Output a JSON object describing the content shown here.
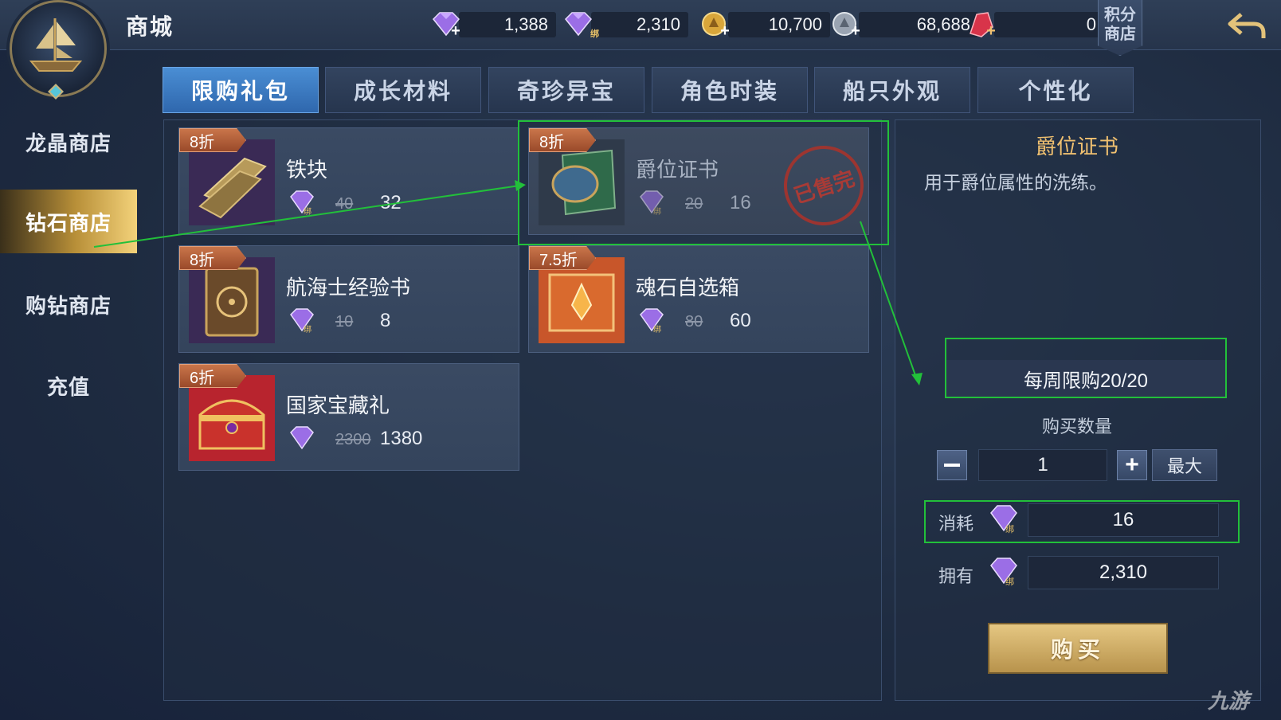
{
  "header": {
    "title": "商城",
    "points_shop_label": "积分商店"
  },
  "currencies": [
    {
      "name": "diamond",
      "value": "1,388"
    },
    {
      "name": "bound-diamond",
      "value": "2,310",
      "tag": "绑"
    },
    {
      "name": "gold",
      "value": "10,700"
    },
    {
      "name": "silver",
      "value": "68,688"
    },
    {
      "name": "red-crystal",
      "value": "0"
    }
  ],
  "sidebar": {
    "items": [
      {
        "label": "龙晶商店",
        "active": false
      },
      {
        "label": "钻石商店",
        "active": true
      },
      {
        "label": "购钻商店",
        "active": false
      },
      {
        "label": "充值",
        "active": false
      }
    ]
  },
  "tabs": [
    {
      "label": "限购礼包",
      "active": true
    },
    {
      "label": "成长材料",
      "active": false
    },
    {
      "label": "奇珍异宝",
      "active": false
    },
    {
      "label": "角色时装",
      "active": false
    },
    {
      "label": "船只外观",
      "active": false
    },
    {
      "label": "个性化",
      "active": false
    }
  ],
  "items": [
    {
      "discount": "8折",
      "name": "铁块",
      "old_price": "40",
      "price": "32",
      "currency_tag": "绑",
      "sold_out": false
    },
    {
      "discount": "8折",
      "name": "爵位证书",
      "old_price": "20",
      "price": "16",
      "currency_tag": "绑",
      "sold_out": true,
      "stamp": "已售完"
    },
    {
      "discount": "8折",
      "name": "航海士经验书",
      "old_price": "10",
      "price": "8",
      "currency_tag": "绑",
      "sold_out": false
    },
    {
      "discount": "7.5折",
      "name": "魂石自选箱",
      "old_price": "80",
      "price": "60",
      "currency_tag": "绑",
      "sold_out": false
    },
    {
      "discount": "6折",
      "name": "国家宝藏礼",
      "old_price": "2300",
      "price": "1380",
      "currency_tag": "",
      "sold_out": false
    }
  ],
  "detail": {
    "title": "爵位证书",
    "description": "用于爵位属性的洗练。",
    "weekly_limit": "每周限购20/20",
    "quantity_label": "购买数量",
    "quantity": "1",
    "max_label": "最大",
    "cost_label": "消耗",
    "cost_value": "16",
    "own_label": "拥有",
    "own_value": "2,310",
    "currency_tag": "绑",
    "buy_label": "购买"
  },
  "watermark": "九游",
  "colors": {
    "accent_gold": "#f0c070",
    "tab_active": "#3f7ec4",
    "highlight_green": "#22c03a",
    "sold_out_red": "#b53a33"
  }
}
